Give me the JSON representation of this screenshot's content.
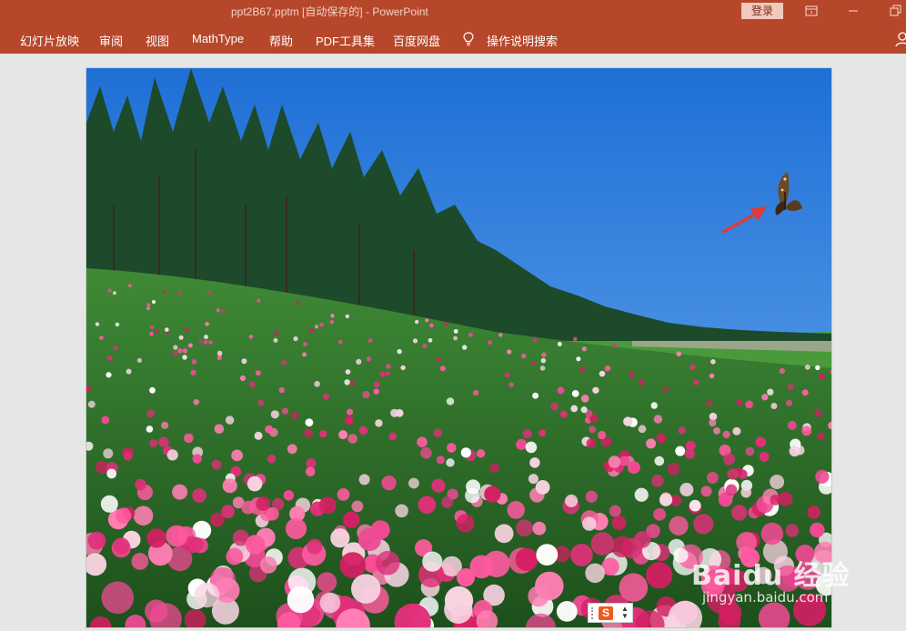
{
  "window": {
    "title": "ppt2B67.pptm [自动保存的]  -  PowerPoint",
    "login_label": "登录",
    "controls": [
      "ribbon-display-icon",
      "minimize-icon",
      "restore-icon"
    ]
  },
  "ribbon": {
    "tabs": [
      "幻灯片放映",
      "审阅",
      "视图",
      "MathType",
      "帮助",
      "PDF工具集",
      "百度网盘"
    ],
    "tell_me": "操作说明搜索",
    "icons": [
      "lightbulb-icon",
      "account-icon"
    ]
  },
  "slide": {
    "image_description_icon": "flower-field-photo",
    "annotation_icon": "red-arrow-icon",
    "subject_icon": "butterfly-icon"
  },
  "ime": {
    "logo_letter": "S",
    "icon": "sogou-ime-icon"
  },
  "watermark": {
    "brand": "Baidu 经验",
    "url": "jingyan.baidu.com"
  },
  "colors": {
    "titlebar": "#b7472a",
    "canvas": "#e6e6e6",
    "sky": "#2f7de0",
    "arrow": "#e03a3a"
  }
}
